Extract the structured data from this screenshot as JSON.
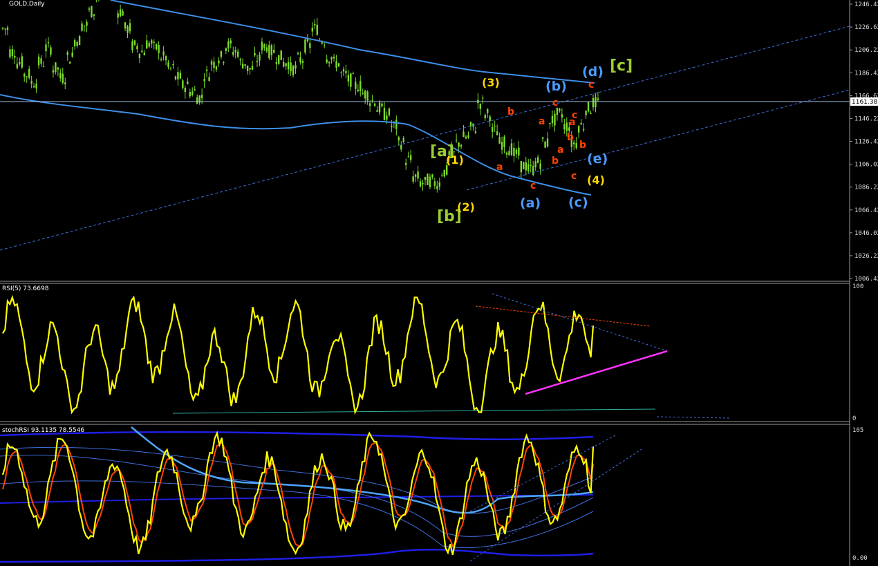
{
  "window": {
    "title": "GOLD,Daily",
    "current_price": "1161.38"
  },
  "colors": {
    "background": "#000000",
    "candle": "#7cdc2a",
    "ma_line": "#3d8fe8",
    "channel": "#3d6fdc",
    "rsi_line": "#ffff00",
    "support": "#ff33ff",
    "stoch_fast": "#ffff00",
    "stoch_slow": "#ff4500",
    "bands": "#1e1ee6"
  },
  "main_axis": {
    "ticks": [
      "1246.42",
      "1226.62",
      "1206.22",
      "1186.42",
      "1166.62",
      "1146.22",
      "1126.42",
      "1106.02",
      "1086.22",
      "1066.42",
      "1046.02",
      "1026.22",
      "1006.42"
    ]
  },
  "rsi_panel": {
    "title": "RSI(5) 73.6698",
    "ticks": [
      "100",
      "0"
    ]
  },
  "stoch_panel": {
    "title": "stochRSI 93.1135 78.5546",
    "ticks": [
      "105",
      "0.00"
    ]
  },
  "wave_labels": [
    {
      "text": "[a]",
      "color": "#9acd32"
    },
    {
      "text": "[b]",
      "color": "#9acd32"
    },
    {
      "text": "[c]",
      "color": "#9acd32"
    },
    {
      "text": "(1)",
      "color": "#ffd700"
    },
    {
      "text": "(2)",
      "color": "#ffd700"
    },
    {
      "text": "(3)",
      "color": "#ffd700"
    },
    {
      "text": "(4)",
      "color": "#ffd700"
    },
    {
      "text": "(a)",
      "color": "#4a9aff"
    },
    {
      "text": "(b)",
      "color": "#4a9aff"
    },
    {
      "text": "(c)",
      "color": "#4a9aff"
    },
    {
      "text": "(d)",
      "color": "#4a9aff"
    },
    {
      "text": "(e)",
      "color": "#4a9aff"
    },
    {
      "text": "a",
      "color": "#ff4500"
    },
    {
      "text": "b",
      "color": "#ff4500"
    },
    {
      "text": "c",
      "color": "#ff4500"
    },
    {
      "text": "c",
      "color": "#ff4500"
    },
    {
      "text": "a",
      "color": "#ff4500"
    },
    {
      "text": "b",
      "color": "#ff4500"
    },
    {
      "text": "a",
      "color": "#ff4500"
    },
    {
      "text": "b",
      "color": "#ff4500"
    },
    {
      "text": "c",
      "color": "#ff4500"
    },
    {
      "text": "a",
      "color": "#ff4500"
    },
    {
      "text": "b",
      "color": "#ff4500"
    },
    {
      "text": "c",
      "color": "#ff4500"
    },
    {
      "text": "c",
      "color": "#ff4500"
    }
  ],
  "chart_data": {
    "type": "line",
    "subtype": "candlestick with indicators",
    "symbol": "GOLD",
    "timeframe": "Daily",
    "ylim": [
      1006.42,
      1246.42
    ],
    "last_close": 1161.38,
    "close_series": [
      1225,
      1205,
      1195,
      1185,
      1178,
      1195,
      1208,
      1190,
      1182,
      1200,
      1215,
      1228,
      1240,
      1255,
      1262,
      1258,
      1240,
      1225,
      1210,
      1205,
      1212,
      1208,
      1200,
      1190,
      1182,
      1175,
      1170,
      1165,
      1185,
      1195,
      1200,
      1210,
      1205,
      1195,
      1190,
      1198,
      1210,
      1205,
      1200,
      1195,
      1190,
      1198,
      1210,
      1225,
      1215,
      1200,
      1195,
      1185,
      1180,
      1175,
      1168,
      1162,
      1155,
      1150,
      1140,
      1125,
      1110,
      1095,
      1090,
      1092,
      1090,
      1100,
      1115,
      1125,
      1130,
      1138,
      1160,
      1150,
      1135,
      1125,
      1120,
      1115,
      1105,
      1102,
      1108,
      1125,
      1145,
      1150,
      1140,
      1125,
      1140,
      1155,
      1160
    ],
    "rsi": {
      "name": "RSI(5)",
      "last": 73.6698,
      "ylim": [
        0,
        100
      ]
    },
    "stoch_rsi": {
      "name": "stochRSI",
      "values": [
        93.1135,
        78.5546
      ],
      "ylim": [
        0,
        105
      ]
    }
  }
}
